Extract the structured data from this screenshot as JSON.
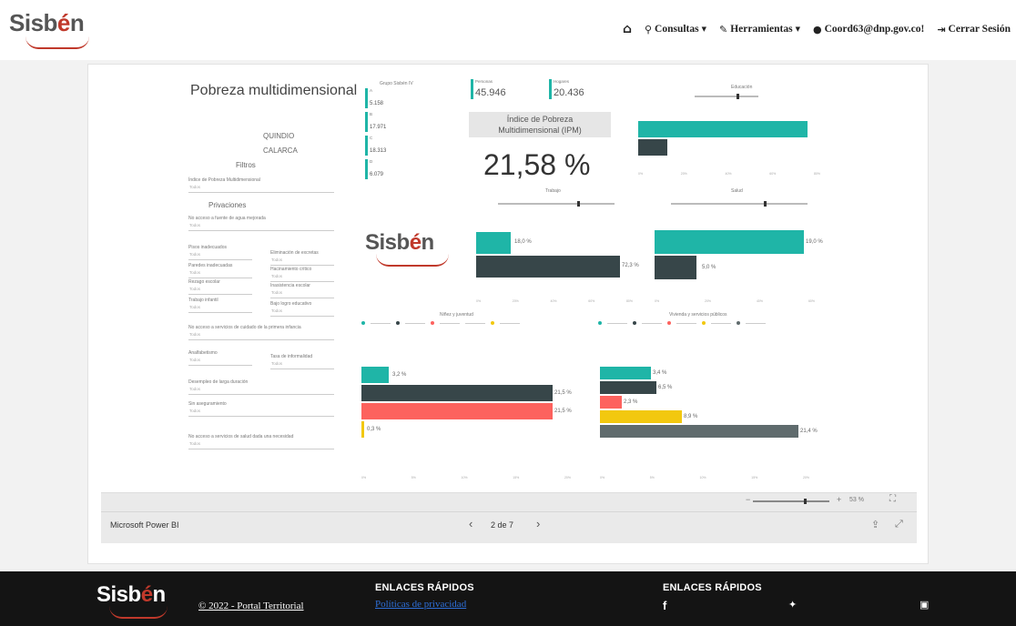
{
  "header": {
    "logo_text_1": "Sisb",
    "logo_text_e": "é",
    "logo_text_2": "n",
    "nav": {
      "home_icon": "home-icon",
      "consultas": "Consultas",
      "herramientas": "Herramientas",
      "user": "Coord63@dnp.gov.co!",
      "logout": "Cerrar Sesión"
    }
  },
  "report": {
    "title": "Pobreza multidimensional",
    "grupo_label": "Grupo Sisbén IV",
    "groups": [
      {
        "letter": "A",
        "value": "5.158"
      },
      {
        "letter": "B",
        "value": "17.971"
      },
      {
        "letter": "C",
        "value": "18.313"
      },
      {
        "letter": "D",
        "value": "6.079"
      }
    ],
    "personas_label": "Personas",
    "personas_value": "45.946",
    "hogares_label": "Hogares",
    "hogares_value": "20.436",
    "ipm_label": "Índice de Pobreza Multidimensional (IPM)",
    "ipm_value": "21,58 %",
    "departamento": "QUINDIO",
    "municipio": "CALARCA",
    "filtros": "Filtros",
    "filtro_ipm": "Índice de Pobreza Multidimensional",
    "privaciones": "Privaciones",
    "priv_items": [
      "No acceso a fuente de agua mejorada",
      "Pisos inadecuados",
      "Eliminación de excretas",
      "Paredes inadecuadas",
      "Hacinamiento crítico",
      "Rezago escolar",
      "Inasistencia escolar",
      "Trabajo infantil",
      "Bajo logro educativo",
      "No acceso a servicios de cuidado de la primera infancia",
      "Analfabetismo",
      "Tasa de informalidad",
      "Desempleo de larga duración",
      "Sin aseguramiento",
      "No acceso a servicios de salud dada una necesidad"
    ],
    "dd_placeholder": "Todos",
    "charts": {
      "educacion": "Educación",
      "trabajo": "Trabajo",
      "salud": "Salud",
      "ninez": "Niñez y juventud",
      "vivienda": "Vivienda y servicios públicos"
    },
    "trabajo_labels": [
      "18,0 %",
      "72,3 %"
    ],
    "salud_labels": [
      "19,0 %",
      "5,0 %"
    ],
    "ninez_labels": [
      "3,2 %",
      "21,5 %",
      "21,5 %",
      "0,3 %"
    ],
    "vivienda_labels": [
      "3,4 %",
      "6,5 %",
      "2,3 %",
      "8,9 %",
      "21,4 %"
    ],
    "colors": {
      "teal": "#1fb5a7",
      "dark": "#374649",
      "red": "#fd625e",
      "yellow": "#f2c80f",
      "gray": "#5f6b6d"
    }
  },
  "pbi": {
    "brand": "Microsoft Power BI",
    "page": "2 de 7",
    "zoom": "53 %"
  },
  "footer": {
    "copyright": "© 2022 - Portal Territorial",
    "head1": "ENLACES RÁPIDOS",
    "link1": "Políticas de privacidad",
    "head2": "ENLACES RÁPIDOS"
  }
}
